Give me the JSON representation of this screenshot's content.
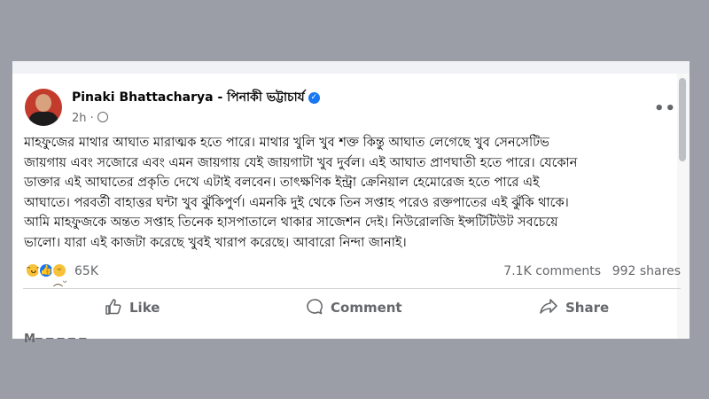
{
  "post": {
    "author": "Pinaki Bhattacharya - পিনাকী ভট্টাচার্য",
    "time": "2h ·",
    "text": "মাহফুজের মাথার আঘাত মারাত্মক হতে পারে। মাথার খুলি খুব শক্ত কিন্তু আঘাত লেগেছে খুব সেনসেটিভ\nজায়গায় এবং সজোরে এবং এমন জায়গায় যেই জায়গাটা খুব দুর্বল। এই আঘাত প্রাণঘাতী হতে পারে। যেকোন\nডাক্তার এই আঘাতের প্রকৃতি দেখে এটাই বলবেন। তাৎক্ষণিক ইন্ট্রা ক্রেনিয়াল হেমোরেজ হতে পারে এই\nআঘাতে। পরবর্তী বাহাত্তর ঘন্টা খুব ঝুঁকিপুর্ণ। এমনকি দুই থেকে তিন সপ্তাহ পরেও রক্তপাতের এই ঝুঁকি থাকে।\nআমি মাহফুজকে অন্তত সপ্তাহ তিনেক হাসপাতালে থাকার সাজেশন দেই। নিউরোলজি ইন্সটিটিউট সবচেয়ে\nভালো। যারা এই কাজটা করেছে খুবই খারাপ করেছে। আবারো নিন্দা জানাই।"
  },
  "stats": {
    "reaction_count": "65K",
    "comments": "7.1K comments",
    "shares": "992 shares"
  },
  "actions": {
    "like": "Like",
    "comment": "Comment",
    "share": "Share"
  },
  "icons": {
    "reactions": [
      "haha-icon",
      "like-icon",
      "sad-icon"
    ],
    "verified": "verified-badge-icon",
    "globe": "globe-icon"
  },
  "colors": {
    "accent": "#1877f2",
    "muted": "#65676b"
  }
}
